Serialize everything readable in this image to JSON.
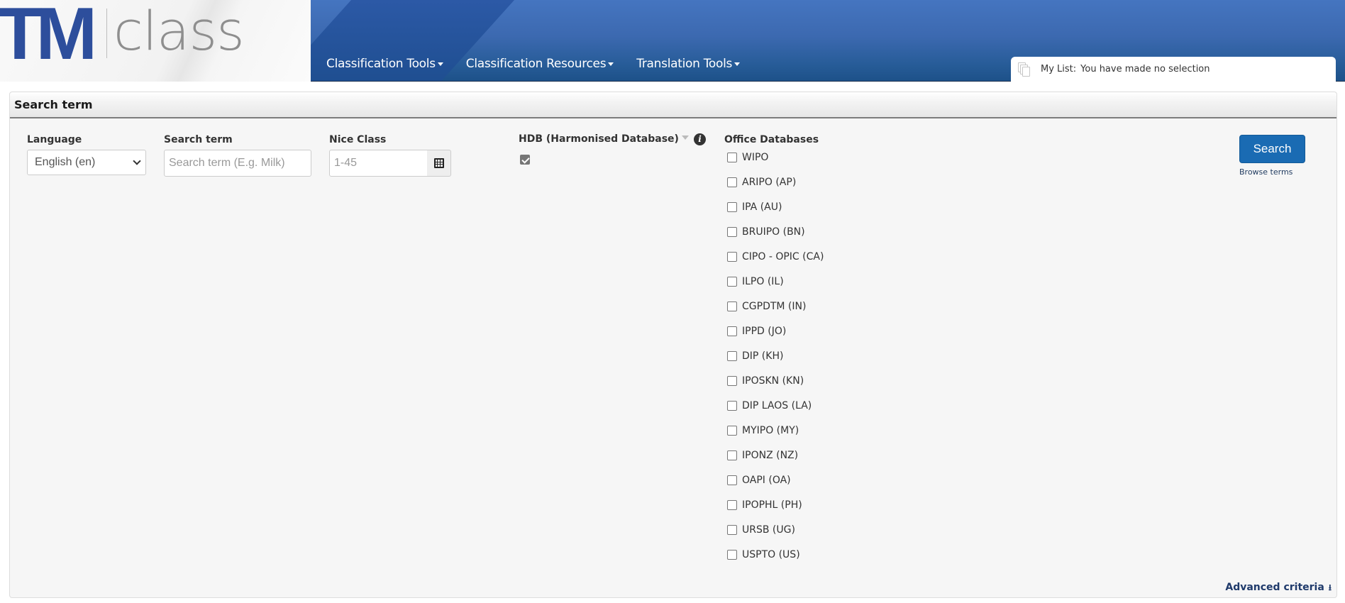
{
  "logo": {
    "brand_mark": "TM",
    "brand_word": "class"
  },
  "nav": {
    "items": [
      {
        "label": "Classification Tools"
      },
      {
        "label": "Classification Resources"
      },
      {
        "label": "Translation Tools"
      }
    ]
  },
  "mylist": {
    "label": "My List:",
    "status": "You have made no selection"
  },
  "panel": {
    "title": "Search term",
    "language": {
      "label": "Language",
      "selected": "English (en)"
    },
    "search_term": {
      "label": "Search term",
      "value": "",
      "placeholder": "Search term (E.g. Milk)"
    },
    "nice_class": {
      "label": "Nice Class",
      "value": "",
      "placeholder": "1-45"
    },
    "hdb": {
      "label": "HDB (Harmonised Database)",
      "checked": true,
      "info_glyph": "i"
    },
    "office_databases": {
      "label": "Office Databases",
      "items": [
        {
          "label": "WIPO",
          "checked": false
        },
        {
          "label": "ARIPO (AP)",
          "checked": false
        },
        {
          "label": "IPA (AU)",
          "checked": false
        },
        {
          "label": "BRUIPO (BN)",
          "checked": false
        },
        {
          "label": "CIPO - OPIC (CA)",
          "checked": false
        },
        {
          "label": "ILPO (IL)",
          "checked": false
        },
        {
          "label": "CGPDTM (IN)",
          "checked": false
        },
        {
          "label": "IPPD (JO)",
          "checked": false
        },
        {
          "label": "DIP (KH)",
          "checked": false
        },
        {
          "label": "IPOSKN (KN)",
          "checked": false
        },
        {
          "label": "DIP LAOS (LA)",
          "checked": false
        },
        {
          "label": "MYIPO (MY)",
          "checked": false
        },
        {
          "label": "IPONZ (NZ)",
          "checked": false
        },
        {
          "label": "OAPI (OA)",
          "checked": false
        },
        {
          "label": "IPOPHL (PH)",
          "checked": false
        },
        {
          "label": "URSB (UG)",
          "checked": false
        },
        {
          "label": "USPTO (US)",
          "checked": false
        }
      ]
    },
    "search_button": "Search",
    "browse_terms": "Browse terms",
    "advanced_criteria": "Advanced criteria",
    "advanced_icon_glyph": "⭳"
  },
  "colors": {
    "brand_blue": "#2d4e9c",
    "nav_blue": "#3c69b0",
    "search_button": "#1a6bb3",
    "link_dark": "#1f3a6b"
  }
}
